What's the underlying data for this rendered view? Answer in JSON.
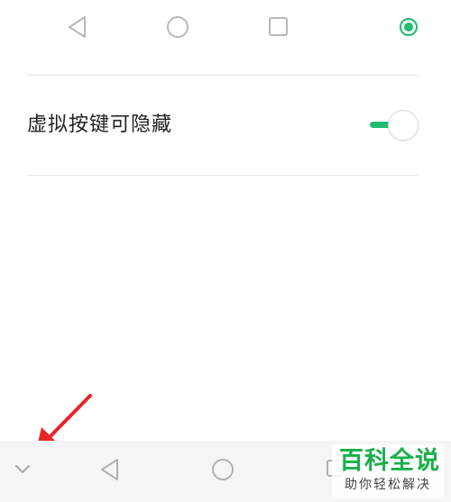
{
  "setting": {
    "label": "虚拟按键可隐藏",
    "toggle_on": true
  },
  "nav_preview": {
    "selected_index": 3,
    "icons": [
      "back-triangle-icon",
      "home-circle-icon",
      "recents-square-icon",
      "radio-selected-icon"
    ]
  },
  "bottom_nav": {
    "icons": [
      "chevron-down-icon",
      "back-triangle-icon",
      "home-circle-icon",
      "recents-square-icon"
    ]
  },
  "watermark": {
    "title": "百科全说",
    "subtitle": "助你轻松解决"
  },
  "colors": {
    "accent_green": "#1ebe6e",
    "watermark_green": "#1aaf4b",
    "annotation_red": "#e8252a",
    "icon_gray": "#b8b8b8"
  }
}
